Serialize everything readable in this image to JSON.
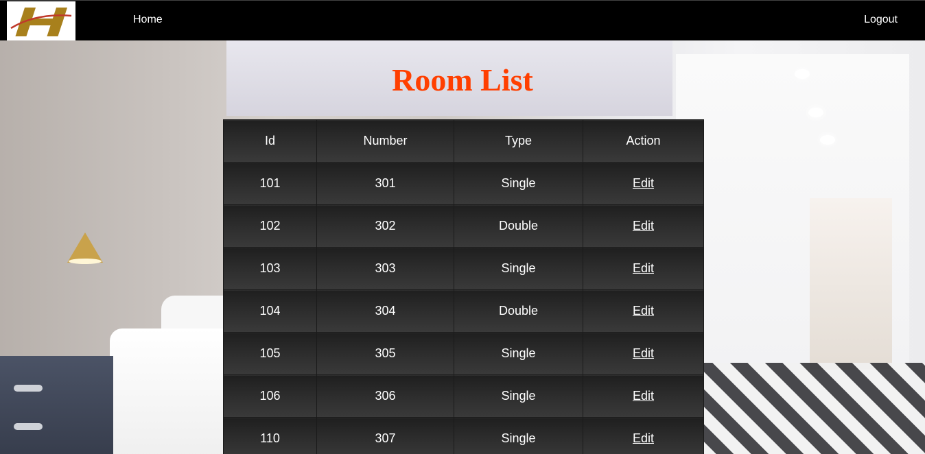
{
  "nav": {
    "logo_letter": "H",
    "home_label": "Home",
    "logout_label": "Logout"
  },
  "page": {
    "title": "Room List"
  },
  "table": {
    "headers": [
      "Id",
      "Number",
      "Type",
      "Action"
    ],
    "rows": [
      {
        "id": "101",
        "number": "301",
        "type": "Single",
        "action": "Edit"
      },
      {
        "id": "102",
        "number": "302",
        "type": "Double",
        "action": "Edit"
      },
      {
        "id": "103",
        "number": "303",
        "type": "Single",
        "action": "Edit"
      },
      {
        "id": "104",
        "number": "304",
        "type": "Double",
        "action": "Edit"
      },
      {
        "id": "105",
        "number": "305",
        "type": "Single",
        "action": "Edit"
      },
      {
        "id": "106",
        "number": "306",
        "type": "Single",
        "action": "Edit"
      },
      {
        "id": "110",
        "number": "307",
        "type": "Single",
        "action": "Edit"
      }
    ]
  },
  "colors": {
    "navbar": "#000000",
    "title": "#ff3f00",
    "logo_gold": "#a8801c",
    "logo_red": "#c0392b",
    "table_cell": "#2c2c2c"
  }
}
